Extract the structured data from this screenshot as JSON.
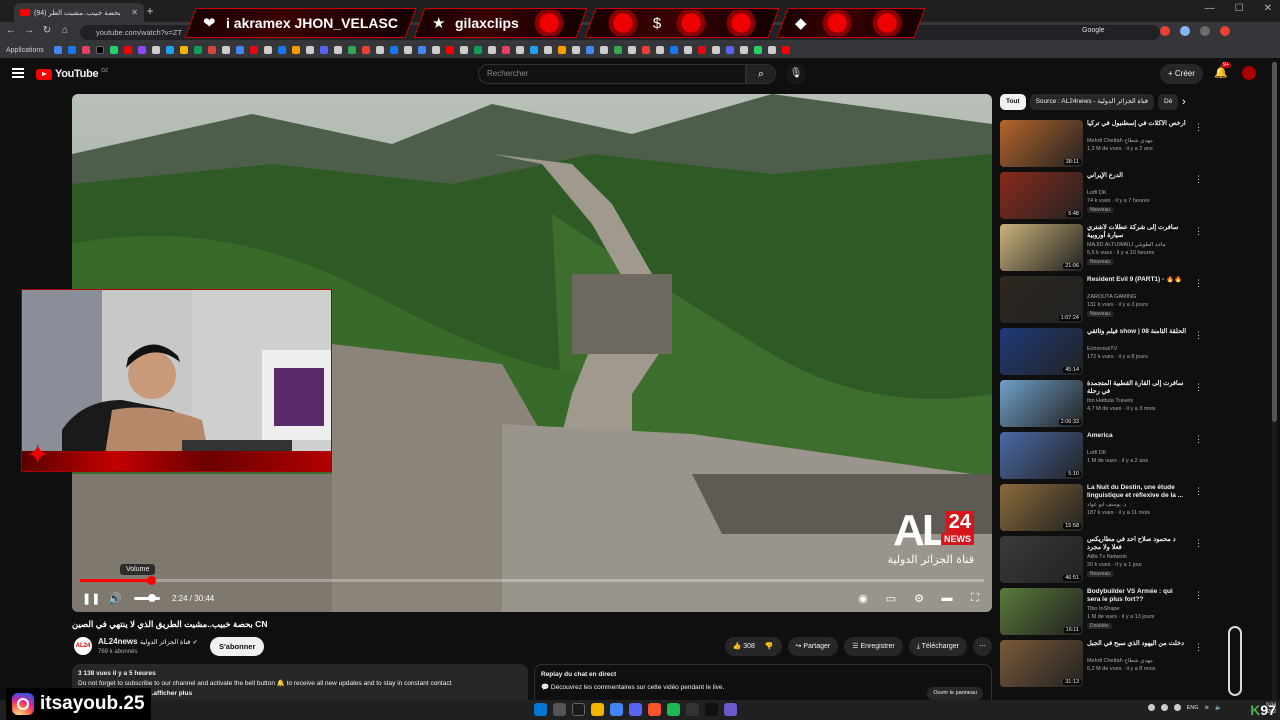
{
  "browser": {
    "tab_title": "بحصة خبيب..مشيت الطر (94)",
    "url": "youtube.com/watch?v=ZT",
    "bookmarks_label": "Applications",
    "google_label": "Google"
  },
  "stream_overlay": {
    "segments": [
      {
        "icon": "heart-icon",
        "text": "i   akramex   JHON_VELASC"
      },
      {
        "icon": "star-icon",
        "text": "gilaxclips"
      },
      {
        "icon": "dollar-icon",
        "text": ""
      },
      {
        "icon": "diamond-icon",
        "text": ""
      }
    ],
    "instagram_handle": "itsayoub.25",
    "counter_prefix": "K",
    "counter_value": "97",
    "accent": "#cc0000"
  },
  "youtube": {
    "logo_text": "YouTube",
    "country_code": "DZ",
    "search_placeholder": "Rechercher",
    "create_label": "Créer",
    "notif_count": "9+"
  },
  "player": {
    "current_time": "2:24",
    "total_time": "30:44",
    "time_display": "2:24 / 30:44",
    "progress_fraction": 0.078,
    "volume_tooltip": "Volume",
    "watermark_main": "AL",
    "watermark_number": "24",
    "watermark_news": "NEWS",
    "watermark_sub": "قناة الجزائر الدولية"
  },
  "video": {
    "title": "بحصة خبيب..مشيت الطريق الذي لا ينتهي في الصين CN",
    "channel_name": "AL24news",
    "channel_name_ar": "قناة الجزائر الدولية",
    "channel_avatar_text": "AL24",
    "subscribers": "769 k abonnés",
    "subscribe_label": "S'abonner",
    "likes": "308",
    "share_label": "Partager",
    "save_label": "Enregistrer",
    "download_label": "Télécharger",
    "description_meta": "3 138 vues  il y a 5 heures",
    "description_text": "Do not forget to subscribe to our channel and activate the bell button 🔔 to receive all new updates and to stay in constant contact",
    "description_more": "...afficher plus",
    "chat_title": "Replay du chat en direct",
    "chat_text": "Découvrez les commentaires sur cette vidéo pendant le live.",
    "chat_open": "Ouvrir le panneau"
  },
  "sidebar": {
    "chips": [
      "Tout",
      "Source : AL24news - قناة الجزائر الدولية",
      "Dé"
    ],
    "recommendations": [
      {
        "title": "أرخص الأكلات في إسطنبول في تركيا",
        "channel": "Mehdi Chettah مهدي شطاح",
        "views": "1,2 M de vues · il y a 2 ans",
        "duration": "38:11",
        "badge": "",
        "color": "#b5652b"
      },
      {
        "title": "الدرع الإيراني",
        "channel": "Lotfi DK",
        "views": "74 k vues · il y a 7 heures",
        "duration": "5:48",
        "badge": "Nouveau",
        "color": "#8a2a1c"
      },
      {
        "title": "سافرت إلى شركة عطلات لأشتري سيارة أوروبية",
        "channel": "MAJID ALTUWAILI ماجد الطويلي",
        "views": "5,6 k vues · il y a 10 heures",
        "duration": "21:06",
        "badge": "Nouveau",
        "color": "#c9b27a"
      },
      {
        "title": "Resident Evil 9 (PART1) - 🔥🔥",
        "channel": "ZAROUTA GAMING",
        "views": "131 k vues · il y a 3 jours",
        "duration": "1:07:24",
        "badge": "Nouveau",
        "color": "#2d2720"
      },
      {
        "title": "فيلم وثائقي show | الحلقة الثامنة 08",
        "channel": "EchoroukTV",
        "views": "172 k vues · il y a 8 jours",
        "duration": "45:14",
        "badge": "",
        "color": "#1f3a7a"
      },
      {
        "title": "سافرت إلى القارة القطبية المتجمدة في رحلة",
        "channel": "Ibn Hattuta Travels",
        "views": "4,7 M de vues · il y a 3 mois",
        "duration": "2:06:33",
        "badge": "",
        "color": "#6fa0c8"
      },
      {
        "title": "America",
        "channel": "Lotfi DK",
        "views": "1 M de vues · il y a 2 ans",
        "duration": "5:10",
        "badge": "",
        "color": "#4a6aa8"
      },
      {
        "title": "La Nuit du Destin, une étude linguistique et réflexive de la ...",
        "channel": "د. يوسف أبو عواد",
        "views": "187 k vues · il y a 11 mois",
        "duration": "15:58",
        "badge": "",
        "color": "#8a6a3a"
      },
      {
        "title": "د محمود صلاح أحد في مطاريكس فعلا ولا مجرد",
        "channel": "Alifa Tv Network",
        "views": "20 k vues · il y a 1 jour",
        "duration": "46:51",
        "badge": "Nouveau",
        "color": "#3a3a3a"
      },
      {
        "title": "Bodybuilder VS Armée : qui sera le plus fort??",
        "channel": "Tibo InShape",
        "views": "1 M de vues · il y a 13 jours",
        "duration": "16:11",
        "badge": "Doublée",
        "color": "#5a7a3a"
      },
      {
        "title": "دخلت من اليهود الذي سبح في الجبل",
        "channel": "Mehdi Chettah مهدي شطاح",
        "views": "5,2 M de vues · il y a 8 mois",
        "duration": "31:13",
        "badge": "",
        "color": "#7a5a3a"
      }
    ]
  },
  "taskbar": {
    "language": "ENG",
    "time": "6:04",
    "date": "202"
  }
}
